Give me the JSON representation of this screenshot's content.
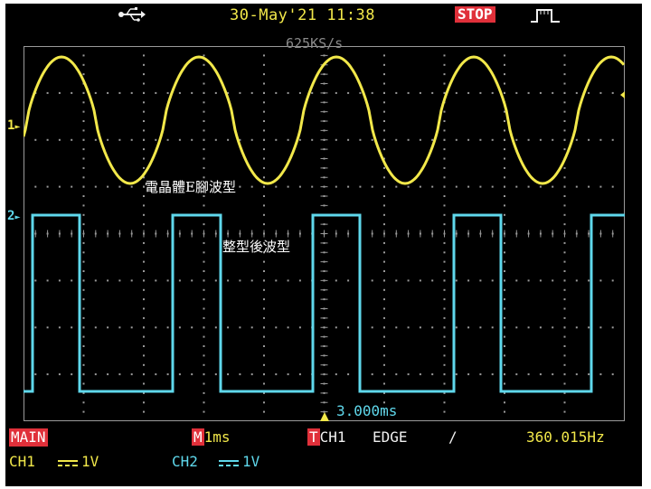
{
  "header": {
    "usb_icon": "usb-icon",
    "datetime": "30-May'21 11:38",
    "run_state": "STOP",
    "trigger_icon": "pulse-icon"
  },
  "screen": {
    "sample_rate": "625KS/s",
    "ch1_marker": "1",
    "ch2_marker": "2",
    "ch1_label": "電晶體E腳波型",
    "ch2_label": "整型後波型",
    "time_reference": "3.000ms"
  },
  "status": {
    "mode": "MAIN",
    "timebase_prefix": "M",
    "timebase": "1ms",
    "trigger_prefix": "T",
    "trigger_source": "CH1",
    "trigger_type": "EDGE",
    "trigger_slope": "/",
    "frequency": "360.015Hz",
    "ch1_name": "CH1",
    "ch1_scale": "1V",
    "ch2_name": "CH2",
    "ch2_scale": "1V"
  },
  "colors": {
    "ch1": "#f2e84a",
    "ch2": "#5fd8ec",
    "grid": "#9a9a9a",
    "alert": "#e0303a"
  }
}
